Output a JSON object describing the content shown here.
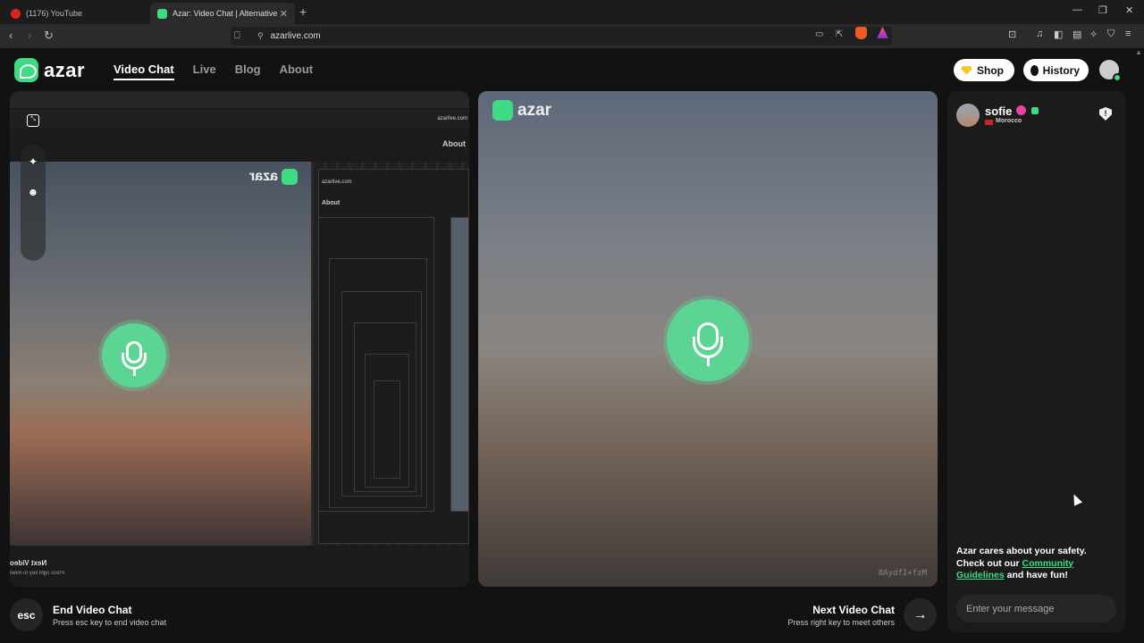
{
  "browser": {
    "tabs": [
      {
        "title": "(1176) YouTube",
        "active": false
      },
      {
        "title": "Azar: Video Chat | Alternative",
        "active": true
      }
    ],
    "url": "azarlive.com"
  },
  "header": {
    "logo_text": "azar",
    "nav": [
      "Video Chat",
      "Live",
      "Blog",
      "About"
    ],
    "shop_label": "Shop",
    "history_label": "History"
  },
  "left_pane": {
    "mirror_url": "azarlive.com",
    "mirror_about": "About",
    "inner_logo": "azar",
    "tunnel_url": "azarlive.com",
    "tunnel_about": "About",
    "next_title": "Next Video",
    "next_sub": "Press right key to meet"
  },
  "right_pane": {
    "logo_text": "azar",
    "watermark": "8AydfI+fzM"
  },
  "controls": {
    "esc_label": "esc",
    "end_title": "End Video Chat",
    "end_sub": "Press esc key to end video chat",
    "next_title": "Next Video Chat",
    "next_sub": "Press right key to meet others"
  },
  "chat": {
    "peer_name": "sofie",
    "peer_country": "Morocco",
    "safety_line1": "Azar cares about your safety.",
    "safety_line2_prefix": "Check out our ",
    "safety_link": "Community Guidelines",
    "safety_suffix": " and have fun!",
    "message_placeholder": "Enter your message"
  },
  "colors": {
    "accent": "#3ddc84",
    "mic": "#5cd494",
    "background": "#121212"
  }
}
